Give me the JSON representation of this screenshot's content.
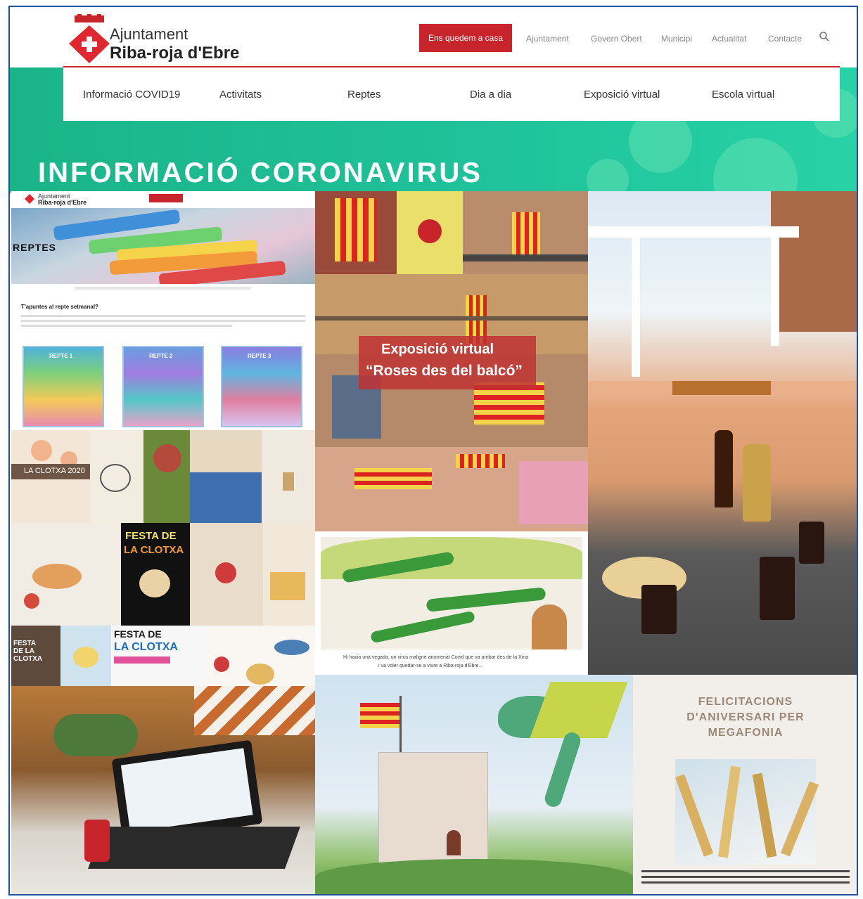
{
  "header": {
    "brand_line1": "Ajuntament",
    "brand_line2": "Riba-roja d'Ebre",
    "cta_label": "Ens quedem a casa",
    "nav": [
      "Ajuntament",
      "Govern Obert",
      "Municipi",
      "Actualitat",
      "Contacte"
    ]
  },
  "menu": [
    "Informació COVID19",
    "Activitats",
    "Reptes",
    "Dia a dia",
    "Exposició virtual",
    "Escola virtual"
  ],
  "banner_title": "INFORMACIÓ CORONAVIRUS",
  "reptes": {
    "brand_line1": "Ajuntament",
    "brand_line2": "Riba-roja d'Ebre",
    "hero_title": "REPTES",
    "question": "T'apuntes al repte setmanal?",
    "cards": [
      "REPTE 1",
      "REPTE 2",
      "REPTE 3"
    ]
  },
  "clotxa": {
    "label_2020": "LA CLOTXA 2020",
    "poster_title_1": "FESTA DE",
    "poster_title_2": "LA CLOTXA",
    "poster2_title_1": "FESTA DE",
    "poster2_title_2": "LA CLOTXA",
    "poster3": "FESTA DE LA CLOTXA"
  },
  "expo": {
    "line1": "Exposició virtual",
    "line2": "“Roses des del balcó”"
  },
  "drawing_caption": {
    "line1": "Hi havia una vegada, un virus maligne anomenat Covid que va arribar des de la Xina",
    "line2": "i va voler quedar-se a viure a Riba-roja d'Ebre..."
  },
  "felicitacions": {
    "title_line1": "FELICITACIONS",
    "title_line2": "D'ANIVERSARI PER",
    "title_line3": "MEGAFONIA"
  },
  "colors": {
    "brand_red": "#c8242b",
    "green": "#1fc29a",
    "frame_border": "#1f4fa0"
  }
}
